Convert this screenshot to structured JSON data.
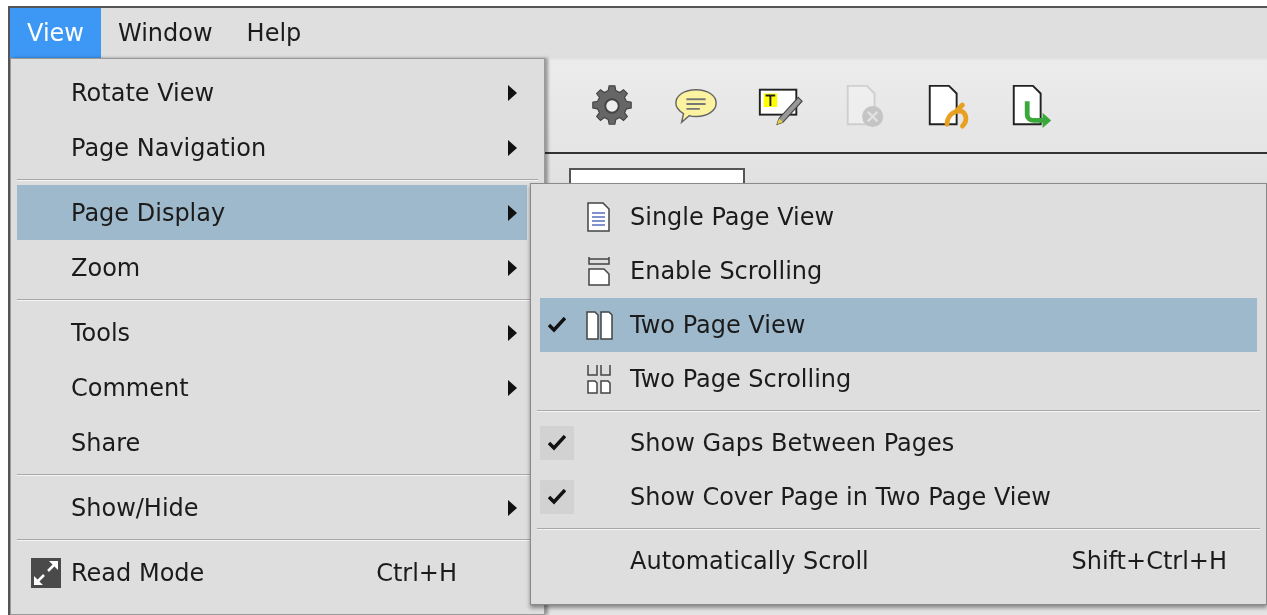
{
  "menu_bar": [
    {
      "label": "View",
      "selected": true
    },
    {
      "label": "Window",
      "selected": false
    },
    {
      "label": "Help",
      "selected": false
    }
  ],
  "toolbar": {
    "buttons": [
      {
        "disabled": false
      },
      {
        "disabled": false
      },
      {
        "disabled": false
      },
      {
        "disabled": true
      },
      {
        "disabled": false
      },
      {
        "disabled": false
      }
    ]
  },
  "view_menu": {
    "items": [
      {
        "kind": "item",
        "label": "Rotate View",
        "submenu": true,
        "highlighted": false
      },
      {
        "kind": "item",
        "label": "Page Navigation",
        "submenu": true,
        "highlighted": false
      },
      {
        "kind": "separator"
      },
      {
        "kind": "item",
        "label": "Page Display",
        "submenu": true,
        "highlighted": true
      },
      {
        "kind": "item",
        "label": "Zoom",
        "submenu": true,
        "highlighted": false
      },
      {
        "kind": "separator"
      },
      {
        "kind": "item",
        "label": "Tools",
        "submenu": true,
        "highlighted": false
      },
      {
        "kind": "item",
        "label": "Comment",
        "submenu": true,
        "highlighted": false
      },
      {
        "kind": "item",
        "label": "Share",
        "submenu": false,
        "highlighted": false
      },
      {
        "kind": "separator"
      },
      {
        "kind": "item",
        "label": "Show/Hide",
        "submenu": true,
        "highlighted": false
      },
      {
        "kind": "separator"
      },
      {
        "kind": "item",
        "label": "Read Mode",
        "shortcut": "Ctrl+H",
        "submenu": false,
        "highlighted": false
      }
    ]
  },
  "page_display_menu": {
    "items": [
      {
        "kind": "item",
        "label": "Single Page View",
        "checked": false,
        "highlighted": false
      },
      {
        "kind": "item",
        "label": "Enable Scrolling",
        "checked": false,
        "highlighted": false
      },
      {
        "kind": "item",
        "label": "Two Page View",
        "checked": true,
        "highlighted": true
      },
      {
        "kind": "item",
        "label": "Two Page Scrolling",
        "checked": false,
        "highlighted": false
      },
      {
        "kind": "separator"
      },
      {
        "kind": "item",
        "label": "Show Gaps Between Pages",
        "checked": true,
        "highlighted": false
      },
      {
        "kind": "item",
        "label": "Show Cover Page in Two Page View",
        "checked": true,
        "highlighted": false
      },
      {
        "kind": "separator"
      },
      {
        "kind": "item",
        "label": "Automatically Scroll",
        "shortcut": "Shift+Ctrl+H",
        "checked": false,
        "highlighted": false
      }
    ]
  }
}
